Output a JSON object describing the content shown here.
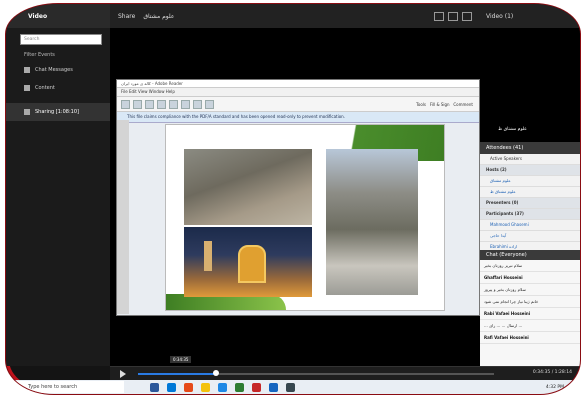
{
  "left_panel": {
    "title": "Video",
    "search_placeholder": "Search",
    "filter_label": "Filter Events",
    "items": [
      {
        "label": "Chat Messages"
      },
      {
        "label": "Content"
      },
      {
        "label": "Sharing [1:08:10]"
      }
    ]
  },
  "share_panel": {
    "title": "Share",
    "title_value": "علوم مشتاق"
  },
  "shared_window": {
    "title_bar": "کاله ی مورد ایران - Adobe Reader",
    "menu": "File  Edit  View  Window  Help",
    "info_bar": "This file claims compliance with the PDF/A standard and has been opened read-only to prevent modification.",
    "tools": [
      "Tools",
      "Fill & Sign",
      "Comment"
    ]
  },
  "video_panel": {
    "title": "Video",
    "count": "(1)",
    "participant_name": "علوم مشتاق ظ"
  },
  "attendees": {
    "title": "Attendees",
    "count": "(41)",
    "active_speakers": "Active Speakers",
    "groups": [
      {
        "label": "Hosts (2)",
        "members": [
          "علوم مشتاق",
          "علوم مشتاق ظ"
        ]
      },
      {
        "label": "Presenters (0)",
        "members": []
      },
      {
        "label": "Participants (37)",
        "members": [
          "Mahmood Ghasemi",
          "آیدا حاجی",
          "Ebrahimi ازاده"
        ]
      }
    ]
  },
  "chat": {
    "title": "Chat",
    "scope": "(Everyone)",
    "messages": [
      "سلام تبریز روزتان بخیر",
      "Ghaffari Hosseini",
      "سلام روزتان بخیر و پیروز",
      "خانم ژینا نیاز چرا انجام نمی شود",
      "Rabi Vafaei Hosseini",
      "... ارسال ... ... رای ...",
      "Rafi Vafaei Hosseini"
    ]
  },
  "timeline": {
    "tooltip": "0:34:35",
    "time": "0:34:35 / 1:28:14",
    "progress": 0.22
  },
  "taskbar": {
    "search_placeholder": "Type here to search",
    "clock": "4:32 PM"
  },
  "colors": {
    "frame_border": "#c0121b",
    "slide_green": "#3e7e23",
    "link_blue": "#1a5fb4"
  }
}
